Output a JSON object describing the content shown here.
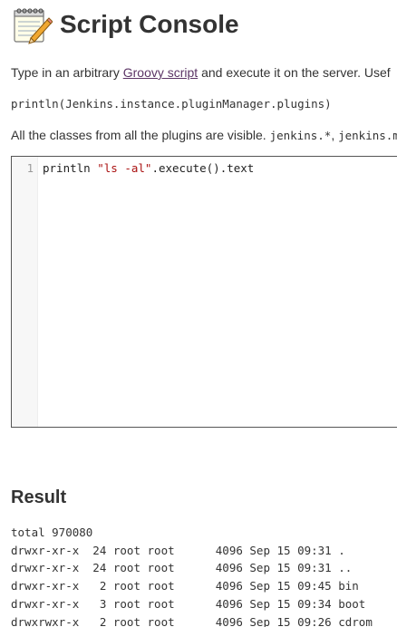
{
  "header": {
    "title": "Script Console",
    "icon": "notepad-icon"
  },
  "intro": {
    "before_link": "Type in an arbitrary ",
    "link_text": "Groovy script",
    "after_link": " and execute it on the server. Usef"
  },
  "example": {
    "code": "println(Jenkins.instance.pluginManager.plugins)"
  },
  "classes_info": {
    "text": "All the classes from all the plugins are visible. ",
    "code1": "jenkins.*",
    "sep": ", ",
    "code2": "jenkins.mo"
  },
  "editor": {
    "line_number": "1",
    "code_prefix": "println ",
    "code_string": "\"ls -al\"",
    "code_suffix": ".execute().text"
  },
  "result": {
    "heading": "Result",
    "output_lines": [
      "total 970080",
      "drwxr-xr-x  24 root root      4096 Sep 15 09:31 .",
      "drwxr-xr-x  24 root root      4096 Sep 15 09:31 ..",
      "drwxr-xr-x   2 root root      4096 Sep 15 09:45 bin",
      "drwxr-xr-x   3 root root      4096 Sep 15 09:34 boot",
      "drwxrwxr-x   2 root root      4096 Sep 15 09:26 cdrom"
    ]
  },
  "colors": {
    "link": "#5c3566",
    "text": "#333333",
    "editor_border": "#555555"
  }
}
